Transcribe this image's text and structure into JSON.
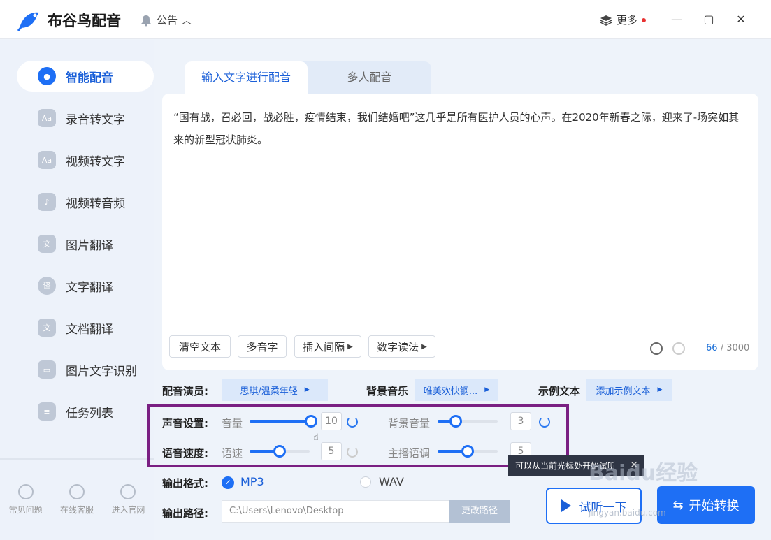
{
  "header": {
    "app_title": "布谷鸟配音",
    "notice_label": "公告",
    "more_label": "更多",
    "minimize": "—",
    "maximize": "▢",
    "close": "✕"
  },
  "sidebar": {
    "items": [
      {
        "label": "智能配音",
        "icon": "smart-dub-icon",
        "active": true
      },
      {
        "label": "录音转文字",
        "icon": "audio-to-text-icon"
      },
      {
        "label": "视频转文字",
        "icon": "video-to-text-icon"
      },
      {
        "label": "视频转音频",
        "icon": "video-to-audio-icon"
      },
      {
        "label": "图片翻译",
        "icon": "image-translate-icon"
      },
      {
        "label": "文字翻译",
        "icon": "text-translate-icon"
      },
      {
        "label": "文档翻译",
        "icon": "doc-translate-icon"
      },
      {
        "label": "图片文字识别",
        "icon": "ocr-icon"
      },
      {
        "label": "任务列表",
        "icon": "task-list-icon"
      }
    ],
    "footer": [
      {
        "label": "常见问题",
        "icon": "faq-icon"
      },
      {
        "label": "在线客服",
        "icon": "support-icon"
      },
      {
        "label": "进入官网",
        "icon": "website-icon"
      }
    ]
  },
  "tabs": [
    {
      "label": "输入文字进行配音",
      "active": true
    },
    {
      "label": "多人配音",
      "active": false
    }
  ],
  "editor": {
    "text": "“国有战，召必回，战必胜，疫情结束，我们结婚吧”这几乎是所有医护人员的心声。在2020年新春之际，迎来了-场突如其来的新型冠状肺炎。",
    "tools": [
      "清空文本",
      "多音字",
      "插入间隔",
      "数字读法"
    ],
    "char_count": "66",
    "char_limit": "/ 3000"
  },
  "settings": {
    "voice_actor_label": "配音演员:",
    "voice_actor_value": "思琪/温柔年轻",
    "bgm_label": "背景音乐",
    "bgm_value": "唯美欢快钢...",
    "sample_label": "示例文本",
    "sample_value": "添加示例文本",
    "sound_label": "声音设置:",
    "volume_label": "音量",
    "volume_value": "10",
    "volume_level": 1.0,
    "bg_volume_label": "背景音量",
    "bg_volume_value": "3",
    "bg_volume_level": 0.3,
    "speed_row_label": "语音速度:",
    "speed_label": "语速",
    "speed_value": "5",
    "speed_level": 0.5,
    "pitch_label": "主播语调",
    "pitch_value": "5",
    "pitch_level": 0.5
  },
  "output": {
    "format_label": "输出格式:",
    "formats": [
      {
        "label": "MP3",
        "selected": true
      },
      {
        "label": "WAV",
        "selected": false
      }
    ],
    "path_label": "输出路径:",
    "path_value": "C:\\Users\\Lenovo\\Desktop",
    "change_path": "更改路径"
  },
  "tooltip": {
    "text": "可以从当前光标处开始试听"
  },
  "actions": {
    "preview": "试听一下",
    "start": "开始转换"
  },
  "watermark": {
    "text": "Baidu经验",
    "sub": "jingyan.baidu.com"
  },
  "colors": {
    "accent": "#1e6ff5",
    "highlight_box": "#7a1f82"
  }
}
